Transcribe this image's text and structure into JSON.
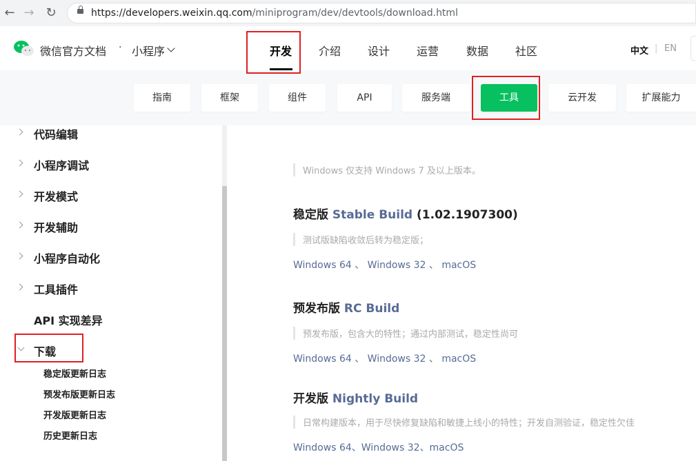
{
  "browser": {
    "url_host": "https://developers.weixin.qq.com",
    "url_path": "/miniprogram/dev/devtools/download.html",
    "back_icon": "←",
    "forward_icon": "→",
    "reload_icon": "↻"
  },
  "header": {
    "brand": "微信官方文档",
    "separator": "·",
    "product": "小程序",
    "nav": [
      {
        "label": "开发",
        "active": true
      },
      {
        "label": "介绍"
      },
      {
        "label": "设计"
      },
      {
        "label": "运营"
      },
      {
        "label": "数据"
      },
      {
        "label": "社区"
      }
    ],
    "lang_zh": "中文",
    "lang_divider": "|",
    "lang_en": "EN"
  },
  "subnav": [
    {
      "label": "指南"
    },
    {
      "label": "框架"
    },
    {
      "label": "组件"
    },
    {
      "label": "API"
    },
    {
      "label": "服务端"
    },
    {
      "label": "工具",
      "active": true
    },
    {
      "label": "云开发"
    },
    {
      "label": "扩展能力"
    }
  ],
  "sidebar": {
    "items": [
      {
        "label": "代码编辑"
      },
      {
        "label": "小程序调试"
      },
      {
        "label": "开发模式"
      },
      {
        "label": "开发辅助"
      },
      {
        "label": "小程序自动化"
      },
      {
        "label": "工具插件"
      },
      {
        "label": "API 实现差异"
      },
      {
        "label": "下载"
      }
    ],
    "subitems": [
      {
        "label": "稳定版更新日志"
      },
      {
        "label": "预发布版更新日志"
      },
      {
        "label": "开发版更新日志"
      },
      {
        "label": "历史更新日志"
      }
    ]
  },
  "content": {
    "windows_note": "Windows 仅支持 Windows 7 及以上版本。",
    "stable": {
      "title_cn": "稳定版",
      "title_en": "Stable Build",
      "version": "(1.02.1907300)",
      "note": "测试版缺陷收敛后转为稳定版；",
      "link1": "Windows 64",
      "sep1": " 、 ",
      "link2": "Windows 32",
      "sep2": " 、 ",
      "link3": "macOS"
    },
    "rc": {
      "title_cn": "预发布版",
      "title_en": "RC Build",
      "note": "预发布版，包含大的特性；通过内部测试，稳定性尚可",
      "link1": "Windows 64",
      "sep1": " 、 ",
      "link2": "Windows 32",
      "sep2": " 、 ",
      "link3": "macOS"
    },
    "nightly": {
      "title_cn": "开发版",
      "title_en": "Nightly Build",
      "note": "日常构建版本，用于尽快修复缺陷和敏捷上线小的特性；开发自测验证，稳定性欠佳",
      "link1": "Windows 64",
      "sep1": "、",
      "link2": "Windows 32",
      "sep2": "、",
      "link3": "macOS"
    }
  },
  "colors": {
    "accent_green": "#07c160",
    "link_blue": "#576b95",
    "highlight_red": "#e02020"
  }
}
